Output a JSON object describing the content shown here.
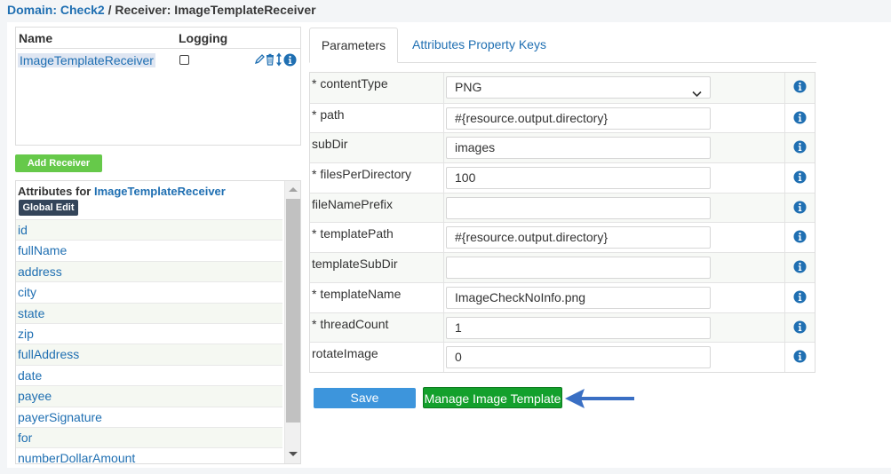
{
  "breadcrumb": {
    "domain_label": "Domain: Check2",
    "separator": " / ",
    "receiver_label": "Receiver: ImageTemplateReceiver"
  },
  "receivers": {
    "col_name": "Name",
    "col_logging": "Logging",
    "rows": [
      {
        "name": "ImageTemplateReceiver",
        "logging": false
      }
    ],
    "add_label": "Add Receiver"
  },
  "attributes": {
    "title_prefix": "Attributes for ",
    "receiver_name": "ImageTemplateReceiver",
    "global_edit_label": "Global Edit",
    "items": [
      "id",
      "fullName",
      "address",
      "city",
      "state",
      "zip",
      "fullAddress",
      "date",
      "payee",
      "payerSignature",
      "for",
      "numberDollarAmount"
    ]
  },
  "tabs": {
    "parameters": "Parameters",
    "attributes_keys": "Attributes Property Keys"
  },
  "parameters": [
    {
      "label": "* contentType",
      "value": "PNG",
      "type": "select"
    },
    {
      "label": "* path",
      "value": "#{resource.output.directory}"
    },
    {
      "label": "subDir",
      "value": "images"
    },
    {
      "label": "* filesPerDirectory",
      "value": "100"
    },
    {
      "label": "fileNamePrefix",
      "value": ""
    },
    {
      "label": "* templatePath",
      "value": "#{resource.output.directory}"
    },
    {
      "label": "templateSubDir",
      "value": ""
    },
    {
      "label": "* templateName",
      "value": "ImageCheckNoInfo.png"
    },
    {
      "label": "* threadCount",
      "value": "1"
    },
    {
      "label": "rotateImage",
      "value": "0"
    }
  ],
  "actions": {
    "save_label": "Save",
    "manage_label": "Manage Image Template"
  },
  "colors": {
    "link": "#1f6fb2",
    "save": "#3d95dc",
    "manage": "#13a02c",
    "add": "#66c94a",
    "global_edit": "#34455a",
    "arrow": "#3a6fc4"
  },
  "icons": {
    "edit": "pencil-icon",
    "delete": "trash-icon",
    "move": "updown-arrow-icon",
    "info": "info-icon"
  }
}
